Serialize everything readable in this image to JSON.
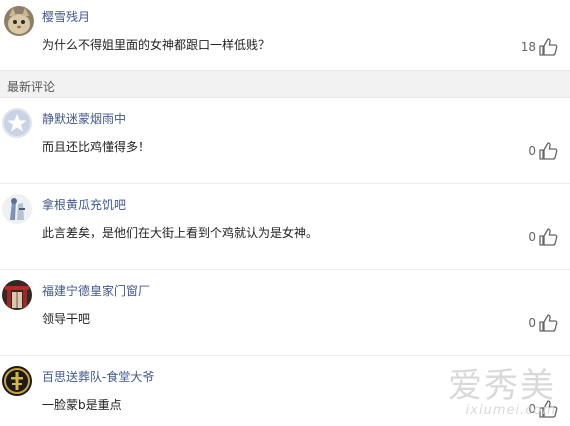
{
  "top_comment": {
    "username": "樱雪残月",
    "text": "为什么不得姐里面的女神都跟口一样低贱？",
    "likes": "18"
  },
  "section": {
    "title": "最新评论"
  },
  "comments": [
    {
      "username": "静默迷蒙烟雨中",
      "text": "而且还比鸡懂得多！",
      "likes": "0",
      "avatar": "default-star-avatar"
    },
    {
      "username": "拿根黄瓜充饥吧",
      "text": "此言差矣，是他们在大街上看到个鸡就认为是女神。",
      "likes": "0",
      "avatar": "sketch-avatar"
    },
    {
      "username": "福建宁德皇家门窗厂",
      "text": "领导干吧",
      "likes": "0",
      "avatar": "gate-avatar"
    },
    {
      "username": "百思送葬队-食堂大爷",
      "text": "一脸蒙b是重点",
      "likes": "0",
      "avatar": "gold-emblem-avatar"
    }
  ],
  "watermark": {
    "cn": "爱秀美",
    "en": "ixiumei.com"
  },
  "colors": {
    "username": "#40588f",
    "section_bg": "#f2f2f2"
  }
}
